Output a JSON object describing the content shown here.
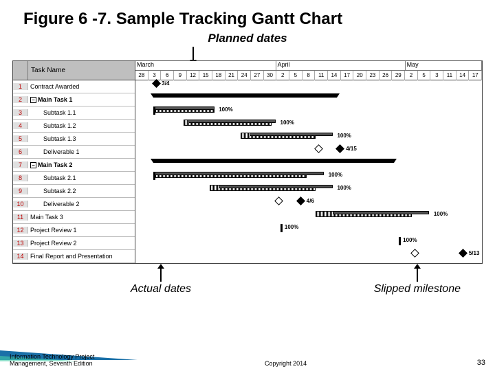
{
  "title": "Figure 6 -7. Sample Tracking Gantt Chart",
  "annotations": {
    "top": "Planned dates",
    "bottom_left": "Actual dates",
    "bottom_right": "Slipped milestone"
  },
  "header": {
    "task_name": "Task Name"
  },
  "months": [
    {
      "label": "March",
      "width_pct": 40.6
    },
    {
      "label": "April",
      "width_pct": 37.3
    },
    {
      "label": "May",
      "width_pct": 22.1
    }
  ],
  "days": [
    "28",
    "3",
    "6",
    "9",
    "12",
    "15",
    "18",
    "21",
    "24",
    "27",
    "30",
    "2",
    "5",
    "8",
    "11",
    "14",
    "17",
    "20",
    "23",
    "26",
    "29",
    "2",
    "5",
    "3",
    "11",
    "14",
    "17"
  ],
  "tasks": [
    {
      "n": "1",
      "name": "Contract Awarded"
    },
    {
      "n": "2",
      "name": "Main Task 1",
      "bold": true,
      "outline": "–"
    },
    {
      "n": "3",
      "name": "Subtask 1.1",
      "indent": true
    },
    {
      "n": "4",
      "name": "Subtask 1.2",
      "indent": true
    },
    {
      "n": "5",
      "name": "Subtask 1.3",
      "indent": true
    },
    {
      "n": "6",
      "name": "Deliverable 1",
      "indent": true
    },
    {
      "n": "7",
      "name": "Main Task 2",
      "bold": true,
      "outline": "–"
    },
    {
      "n": "8",
      "name": "Subtask 2.1",
      "indent": true
    },
    {
      "n": "9",
      "name": "Subtask 2.2",
      "indent": true
    },
    {
      "n": "10",
      "name": "Deliverable 2",
      "indent": true
    },
    {
      "n": "11",
      "name": "Main Task 3"
    },
    {
      "n": "12",
      "name": "Project Review 1"
    },
    {
      "n": "13",
      "name": "Project Review 2"
    },
    {
      "n": "14",
      "name": "Final Report and Presentation"
    }
  ],
  "chart_data": {
    "type": "gantt",
    "title": "Sample Tracking Gantt Chart",
    "x_axis": {
      "start": "Feb 28",
      "end": "May 17",
      "months": [
        "March",
        "April",
        "May"
      ],
      "ticks": [
        "28",
        "3",
        "6",
        "9",
        "12",
        "15",
        "18",
        "21",
        "24",
        "27",
        "30",
        "2",
        "5",
        "8",
        "11",
        "14",
        "17",
        "20",
        "23",
        "26",
        "29",
        "2",
        "5",
        "3",
        "11",
        "14",
        "17"
      ]
    },
    "tasks": [
      {
        "id": 1,
        "name": "Contract Awarded",
        "type": "milestone",
        "planned": "3/4",
        "actual": "3/4",
        "label": "3/4"
      },
      {
        "id": 2,
        "name": "Main Task 1",
        "type": "summary",
        "planned_start": "3/4",
        "planned_end": "4/15"
      },
      {
        "id": 3,
        "name": "Subtask 1.1",
        "planned_start": "3/4",
        "planned_end": "3/18",
        "actual_start": "3/4",
        "actual_end": "3/18",
        "percent_complete": 100
      },
      {
        "id": 4,
        "name": "Subtask 1.2",
        "planned_start": "3/11",
        "planned_end": "3/31",
        "actual_start": "3/12",
        "actual_end": "4/1",
        "percent_complete": 100
      },
      {
        "id": 5,
        "name": "Subtask 1.3",
        "planned_start": "3/24",
        "planned_end": "4/10",
        "actual_start": "3/26",
        "actual_end": "4/14",
        "percent_complete": 100
      },
      {
        "id": 6,
        "name": "Deliverable 1",
        "type": "milestone",
        "planned": "4/10",
        "actual": "4/15",
        "label": "4/15",
        "slipped": true
      },
      {
        "id": 7,
        "name": "Main Task 2",
        "type": "summary",
        "planned_start": "3/4",
        "planned_end": "4/28"
      },
      {
        "id": 8,
        "name": "Subtask 2.1",
        "planned_start": "3/4",
        "planned_end": "4/8",
        "actual_start": "3/4",
        "actual_end": "4/12",
        "percent_complete": 100
      },
      {
        "id": 9,
        "name": "Subtask 2.2",
        "planned_start": "3/17",
        "planned_end": "4/10",
        "actual_start": "3/19",
        "actual_end": "4/14",
        "percent_complete": 100
      },
      {
        "id": 10,
        "name": "Deliverable 2",
        "type": "milestone",
        "planned": "4/1",
        "actual": "4/6",
        "label": "4/6",
        "slipped": true
      },
      {
        "id": 11,
        "name": "Main Task 3",
        "planned_start": "4/10",
        "planned_end": "5/2",
        "actual_start": "4/14",
        "actual_end": "5/6",
        "percent_complete": 100
      },
      {
        "id": 12,
        "name": "Project Review 1",
        "type": "milestone",
        "planned": "4/2",
        "actual": "4/2",
        "percent_complete": 100
      },
      {
        "id": 13,
        "name": "Project Review 2",
        "type": "milestone",
        "planned": "4/29",
        "actual": "4/29",
        "percent_complete": 100
      },
      {
        "id": 14,
        "name": "Final Report and Presentation",
        "type": "milestone",
        "planned": "5/2",
        "actual": "5/13",
        "label": "5/13",
        "slipped": true
      }
    ]
  },
  "footer": {
    "left1": "Information Technology Project",
    "left2": "Management, Seventh Edition",
    "center": "Copyright 2014",
    "page": "33"
  }
}
